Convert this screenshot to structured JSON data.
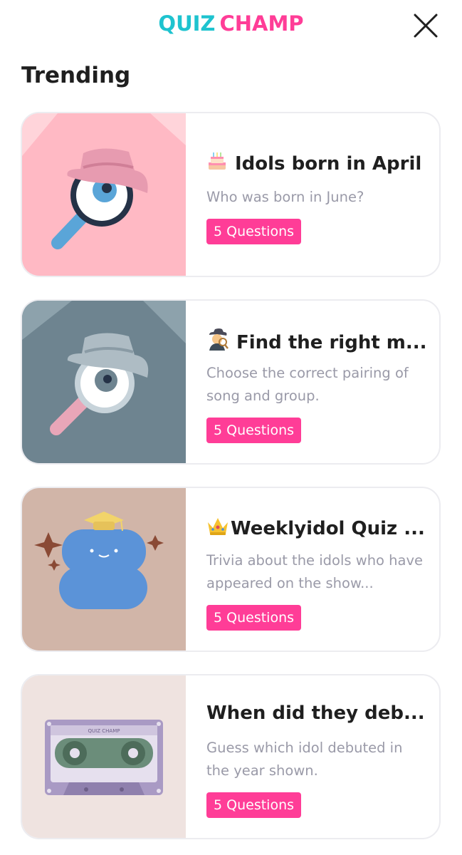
{
  "header": {
    "logo_quiz": "QUIZ",
    "logo_champ": "CHAMP"
  },
  "section": {
    "title": "Trending"
  },
  "quizzes": [
    {
      "title": "Idols born in April",
      "title_icon": "birthday-cake-icon",
      "description": "Who was born in June?",
      "badge": "5 Questions",
      "thumb_bg": "#ffb9c4",
      "thumb_icon": "detective-eye-icon"
    },
    {
      "title": "Find the right m...",
      "title_icon": "detective-icon",
      "description": "Choose the correct pairing of song and group.",
      "badge": "5 Questions",
      "thumb_bg": "#6e8490",
      "thumb_icon": "detective-eye-icon"
    },
    {
      "title": "Weeklyidol Quiz ...",
      "title_icon": "crown-icon",
      "description": "Trivia about the idols who have appeared on the show...",
      "badge": "5 Questions",
      "thumb_bg": "#d1b5a8",
      "thumb_icon": "graduate-blob-icon"
    },
    {
      "title": "When did they deb...",
      "title_icon": "",
      "description": "Guess which idol debuted in the year shown.",
      "badge": "5 Questions",
      "thumb_bg": "#efe3e0",
      "thumb_icon": "cassette-tape-icon",
      "thumb_label": "QUIZ CHAMP"
    }
  ],
  "colors": {
    "accent_pink": "#ff3d97",
    "accent_cyan": "#1ec3cf",
    "muted_text": "#9a9aa8"
  }
}
